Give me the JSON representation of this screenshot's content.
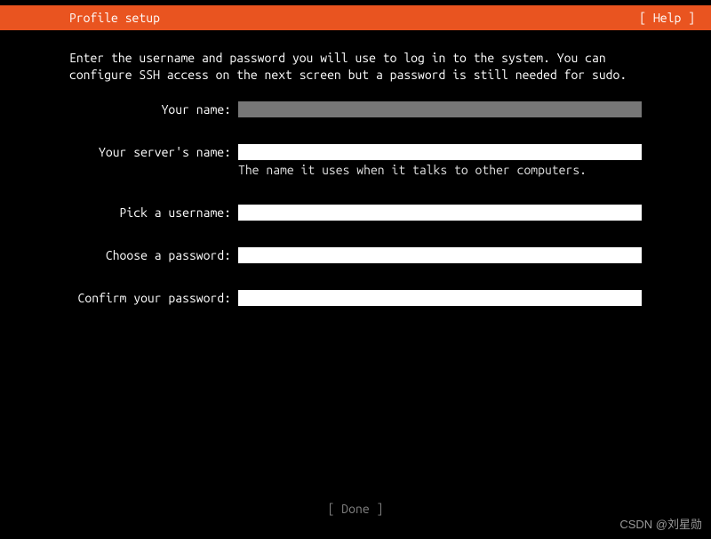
{
  "header": {
    "title": "Profile setup",
    "help": "[ Help ]"
  },
  "instructions": "Enter the username and password you will use to log in to the system. You can configure SSH access on the next screen but a password is still needed for sudo.",
  "fields": {
    "name": {
      "label": "Your name:",
      "value": ""
    },
    "server": {
      "label": "Your server's name:",
      "value": "",
      "hint": "The name it uses when it talks to other computers."
    },
    "username": {
      "label": "Pick a username:",
      "value": ""
    },
    "password": {
      "label": "Choose a password:",
      "value": ""
    },
    "confirm": {
      "label": "Confirm your password:",
      "value": ""
    }
  },
  "footer": {
    "done": "[ Done       ]"
  },
  "watermark": "CSDN @刘星勋"
}
